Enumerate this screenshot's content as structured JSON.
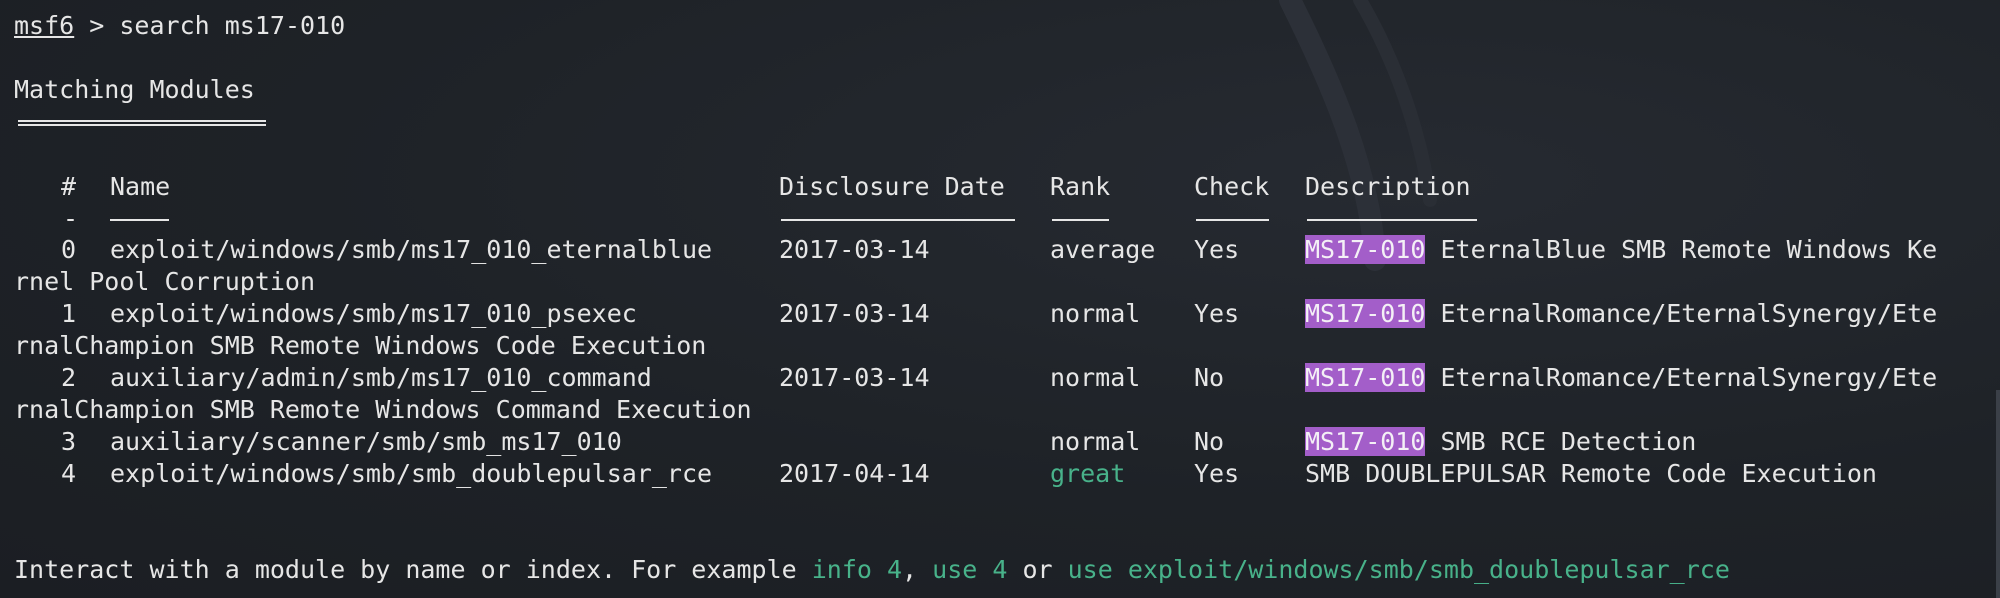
{
  "prompt": {
    "host": "msf6",
    "sep": " > ",
    "command": "search ms17-010"
  },
  "section_title": "Matching Modules",
  "table": {
    "headers": {
      "num": "#",
      "name": "Name",
      "date": "Disclosure Date",
      "rank": "Rank",
      "check": "Check",
      "desc": "Description"
    },
    "num_underline": "-",
    "rows": [
      {
        "num": "0",
        "name": "exploit/windows/smb/ms17_010_eternalblue",
        "date": "2017-03-14",
        "rank": "average",
        "check": "Yes",
        "highlight": "MS17-010",
        "desc_line1": " EternalBlue SMB Remote Windows Ke",
        "desc_line2": "rnel Pool Corruption"
      },
      {
        "num": "1",
        "name": "exploit/windows/smb/ms17_010_psexec",
        "date": "2017-03-14",
        "rank": "normal",
        "check": "Yes",
        "highlight": "MS17-010",
        "desc_line1": " EternalRomance/EternalSynergy/Ete",
        "desc_line2": "rnalChampion SMB Remote Windows Code Execution"
      },
      {
        "num": "2",
        "name": "auxiliary/admin/smb/ms17_010_command",
        "date": "2017-03-14",
        "rank": "normal",
        "check": "No",
        "highlight": "MS17-010",
        "desc_line1": " EternalRomance/EternalSynergy/Ete",
        "desc_line2": "rnalChampion SMB Remote Windows Command Execution"
      },
      {
        "num": "3",
        "name": "auxiliary/scanner/smb/smb_ms17_010",
        "date": "",
        "rank": "normal",
        "check": "No",
        "highlight": "MS17-010",
        "desc_line1": " SMB RCE Detection",
        "desc_line2": ""
      },
      {
        "num": "4",
        "name": "exploit/windows/smb/smb_doublepulsar_rce",
        "date": "2017-04-14",
        "rank": "great",
        "check": "Yes",
        "highlight": "",
        "desc_line1": "SMB DOUBLEPULSAR Remote Code Execution",
        "desc_line2": ""
      }
    ]
  },
  "footer": {
    "text1": "Interact with a module by name or index. For example ",
    "cmd1": "info 4",
    "sep1": ", ",
    "cmd2": "use 4",
    "sep2": " or ",
    "cmd3": "use exploit/windows/smb/smb_doublepulsar_rce"
  },
  "colors": {
    "background": "#1e2227",
    "text": "#e6e6e6",
    "highlight_bg": "#a35ec9",
    "green": "#48b28a"
  }
}
